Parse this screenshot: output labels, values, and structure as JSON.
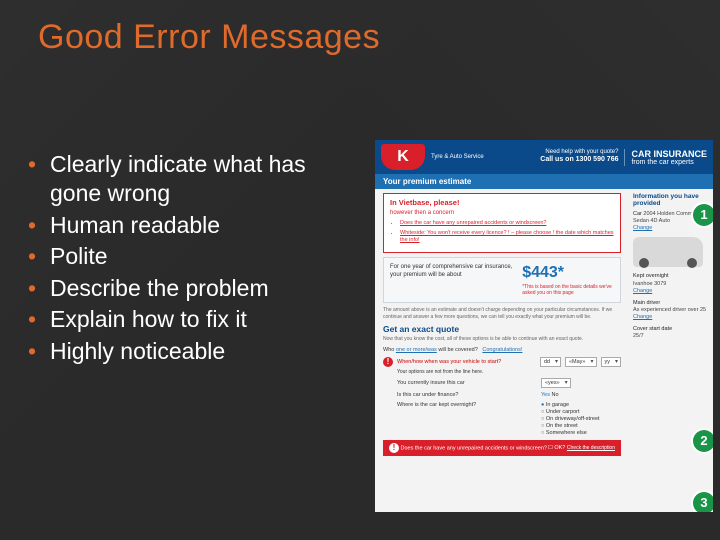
{
  "slide": {
    "title": "Good Error Messages",
    "bullets": [
      "Clearly indicate what has gone wrong",
      "Human readable",
      "Polite",
      "Describe the problem",
      "Explain how to fix it",
      "Highly noticeable"
    ]
  },
  "badges": {
    "one": "1",
    "two": "2",
    "three": "3"
  },
  "shot": {
    "header": {
      "logo_letter": "K",
      "tyre_service": "Tyre & Auto Service",
      "help_label": "Need help with your quote?",
      "help_phone": "Call us on 1300 590 766",
      "car_ins_big": "CAR INSURANCE",
      "car_ins_small": "from the car experts"
    },
    "blue_bar": "Your premium estimate",
    "sidebar": {
      "title": "Information you have provided",
      "car_label": "Car",
      "car_value": "2004 Holden Commodore Sedan 4D Auto",
      "change": "Change",
      "overnight_label": "Kept overnight",
      "overnight_value": "Ivanhoe 3079",
      "driver_label": "Main driver",
      "driver_value": "As experienced driver over 25",
      "cover_label": "Cover start date",
      "cover_value": "25/7"
    },
    "error": {
      "heading": "In Vietbase, please!",
      "subhead": "however then a concern",
      "items": [
        "Does the car have any unrepaired accidents or windscreen?",
        "Whiteside: You won't receive every licence? ! – please choose ! the date which matches the info!"
      ]
    },
    "premium": {
      "lead": "For one year of comprehensive car insurance, your premium will be about",
      "price": "$443*",
      "note": "*This is based on the basic details we've asked you on this page"
    },
    "fineprint": "The amount above is an estimate and doesn't charge depending on your particular circumstances. If we continue and answer a few more questions, we can tell you exactly what your premium will be.",
    "exact": {
      "heading": "Get an exact quote",
      "sub": "Now that you know the cost, all of these options is be able to continue with an exact quote.",
      "who_prefix": "Who",
      "who_link": "one or more/was",
      "who_suffix": "will be covered?",
      "congrats": "Congratulations!"
    },
    "q_dob": {
      "label": "When/how when was your vehicle to start?",
      "dd": "dd",
      "mon": "«May»",
      "yy": "yy",
      "subline": "Your options are not from the line here."
    },
    "q_insure": {
      "label": "You currently insure this car",
      "value": "«yes»"
    },
    "q_finance": {
      "label": "Is this car under finance?",
      "yes": "Yes",
      "no": "No"
    },
    "q_kept": {
      "label": "Where is the car kept overnight?",
      "options": [
        "In garage",
        "Under carport",
        "On driveway/off-street",
        "On the street",
        "Somewhere else"
      ]
    },
    "footer": {
      "q": "Does the car have any unrepaired accidents or windscreen?",
      "ok": "OK?",
      "link": "Check the description"
    }
  }
}
